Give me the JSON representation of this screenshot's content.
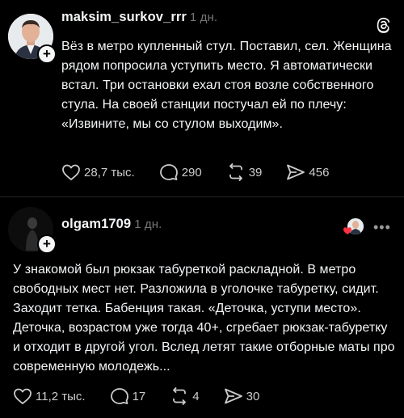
{
  "post1": {
    "username": "maksim_surkov_rrr",
    "time": "1 дн.",
    "text": "Вёз в метро купленный стул. Поставил, сел. Женщина рядом попросила уступить место. Я автоматически встал. Три остановки ехал стоя возле собственного стула. На своей станции постучал ей по плечу: «Извините, мы со стулом выходим».",
    "likes": "28,7 тыс.",
    "comments": "290",
    "reposts": "39",
    "shares": "456"
  },
  "post2": {
    "username": "olgam1709",
    "time": "1 дн.",
    "text": "У знакомой был рюкзак табуреткой раскладной. В метро свободных мест нет. Разложила в уголочке табуретку, сидит. Заходит тетка. Бабенция такая. «Деточка, уступи место». Деточка, возрастом уже тогда 40+, сгребает рюкзак-табуретку и отходит в другой угол. Вслед летят такие отборные маты про современную молодежь...",
    "likes": "11,2 тыс.",
    "comments": "17",
    "reposts": "4",
    "shares": "30",
    "more_label": "•••"
  },
  "icons": {
    "app": "threads-logo-icon",
    "like": "heart-icon",
    "comment": "comment-bubble-icon",
    "repost": "repost-icon",
    "share": "send-icon",
    "follow": "plus-icon"
  },
  "colors": {
    "background": "#000000",
    "text": "#f3f5f7",
    "muted": "#777777",
    "liked_heart": "#ff3040"
  }
}
